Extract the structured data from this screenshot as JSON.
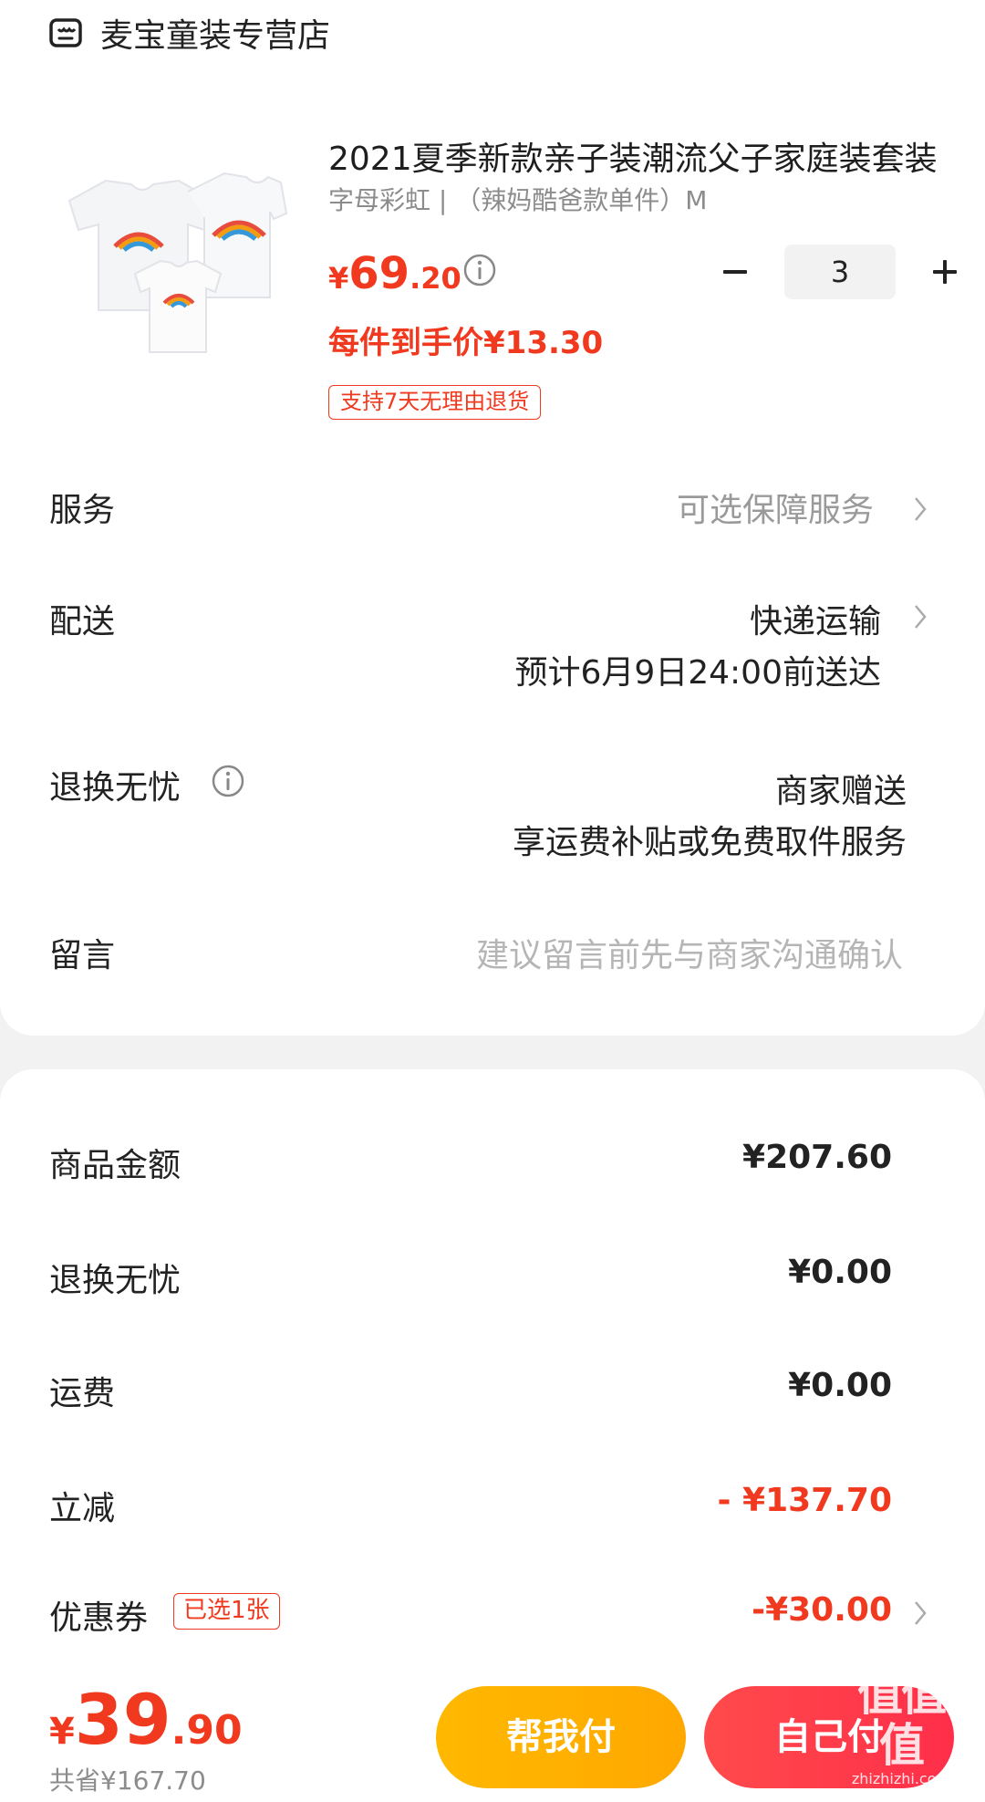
{
  "store": {
    "name": "麦宝童装专营店",
    "icon": "store-icon"
  },
  "product": {
    "title": "2021夏季新款亲子装潮流父子家庭装套装",
    "spec": "字母彩虹 | （辣妈酷爸款单件）M",
    "price_symbol": "¥",
    "price_int": "69",
    "price_dec": ".20",
    "unit_price": "每件到手价¥13.30",
    "return_tag": "支持7天无理由退货",
    "quantity": "3"
  },
  "rows": {
    "service_label": "服务",
    "service_value": "可选保障服务",
    "delivery_label": "配送",
    "delivery_method": "快递运输",
    "delivery_eta": "预计6月9日24:00前送达",
    "return_label": "退换无忧",
    "return_value": "商家赠送",
    "return_desc": "享运费补贴或免费取件服务",
    "note_label": "留言",
    "note_placeholder": "建议留言前先与商家沟通确认"
  },
  "summary": {
    "goods_label": "商品金额",
    "goods_value": "¥207.60",
    "return_label": "退换无忧",
    "return_value": "¥0.00",
    "shipping_label": "运费",
    "shipping_value": "¥0.00",
    "discount_label": "立减",
    "discount_value": "- ¥137.70",
    "coupon_label": "优惠券",
    "coupon_badge": "已选1张",
    "coupon_value": "-¥30.00"
  },
  "footer": {
    "total_symbol": "¥",
    "total_int": "39",
    "total_dec": ".90",
    "saved": "共省¥167.70",
    "help_pay": "帮我付",
    "self_pay": "自己付",
    "watermark_main": "值值值",
    "watermark_sub": "zhizhizhi.com"
  },
  "colors": {
    "accent": "#f0391e",
    "help_pay": "#ffb300",
    "self_pay": "#ff3b4b"
  }
}
